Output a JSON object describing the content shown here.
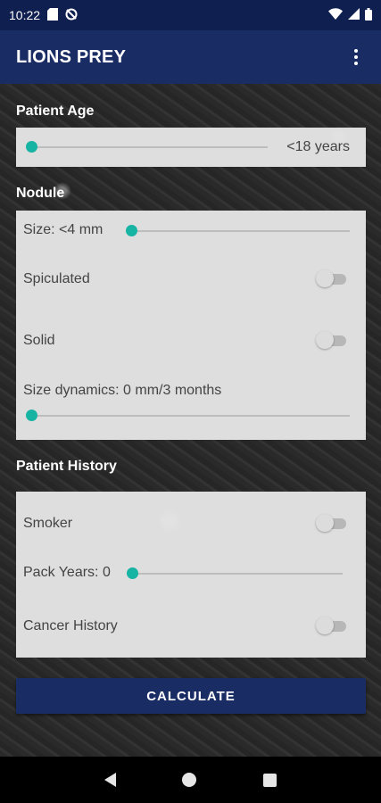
{
  "status_bar": {
    "time": "10:22",
    "icons_left": [
      "sd-card-icon",
      "no-sync-icon"
    ],
    "icons_right": [
      "wifi-icon",
      "signal-icon",
      "battery-icon"
    ]
  },
  "app_bar": {
    "title": "LIONS PREY",
    "menu_icon": "more-vert-icon"
  },
  "patient_age": {
    "section_title": "Patient Age",
    "value_label": "<18 years",
    "slider_fraction": 0.0
  },
  "nodule": {
    "section_title": "Nodule",
    "size_label": "Size: <4 mm",
    "size_slider_fraction": 0.0,
    "spiculated_label": "Spiculated",
    "spiculated_on": false,
    "solid_label": "Solid",
    "solid_on": false,
    "dynamics_label": "Size dynamics: 0 mm/3 months",
    "dynamics_slider_fraction": 0.0
  },
  "patient_history": {
    "section_title": "Patient History",
    "smoker_label": "Smoker",
    "smoker_on": false,
    "pack_years_label": "Pack Years: 0",
    "pack_years_slider_fraction": 0.0,
    "cancer_history_label": "Cancer History",
    "cancer_history_on": false
  },
  "actions": {
    "calculate_label": "CALCULATE"
  },
  "colors": {
    "accent": "#17b3a3",
    "primary": "#1a2c64",
    "status_bar": "#0f1f4f"
  }
}
